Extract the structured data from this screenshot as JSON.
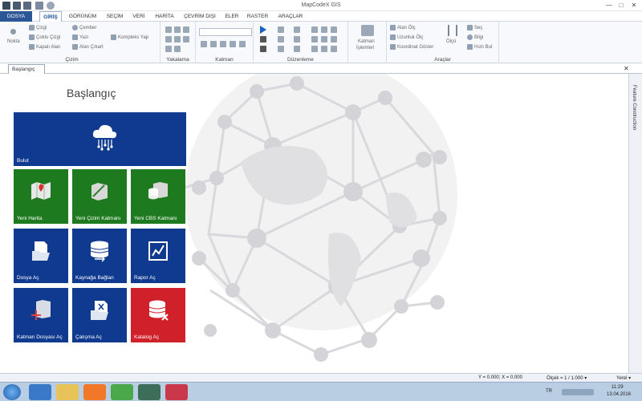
{
  "window": {
    "title": "MapCodeX GIS",
    "minimize": "—",
    "maximize": "□",
    "close": "✕"
  },
  "menu": {
    "tabs": [
      "DOSYA",
      "GİRİŞ",
      "GÖRÜNÜM",
      "SEÇİM",
      "VERİ",
      "HARİTA",
      "ÇEVRİM DIŞI",
      "ELER",
      "RASTER",
      "ARAÇLAR"
    ]
  },
  "ribbon": {
    "nokta": "Nokta",
    "cizim_items": [
      "Çizgi",
      "Çoklu Çizgi",
      "Kapalı Alan",
      "Çember",
      "Yazı",
      "Alan Çıkart",
      "Kompleks Yap"
    ],
    "groups": {
      "cizim": "Çizim",
      "yakalama": "Yakalama",
      "katman": "Katman",
      "duzenleme": "Düzenleme",
      "araclar": "Araçlar"
    },
    "katman_islemleri": [
      "Katman",
      "İşlemleri"
    ],
    "araclar_items": [
      "Alan Ölç",
      "Uzunluk Ölç",
      "Koordinat Göster",
      "Ölçü",
      "Seç",
      "Bilgi",
      "Hızlı Bul"
    ]
  },
  "doc": {
    "tab": "Başlangıç",
    "close": "✕"
  },
  "start": {
    "title": "Başlangıç",
    "tiles": [
      "Bulut",
      "Yeni Harita",
      "Yeni Çizim Katmanı",
      "Yeni CBS Katmanı",
      "Dosya Aç",
      "Kaynağa Bağlan",
      "Rapor Aç",
      "Katman Dosyası Aç",
      "Çalışma Aç",
      "Katalog Aç"
    ]
  },
  "right_panel": {
    "label": "Feature Construction"
  },
  "status": {
    "coords": "Y = 0.000; X = 0.000",
    "scale": "Ölçek = 1 / 1.000 ▾",
    "mode": "Yerel ▾"
  },
  "taskbar": {
    "lang": "TR",
    "time": "11:29",
    "date": "13.04.2016"
  }
}
